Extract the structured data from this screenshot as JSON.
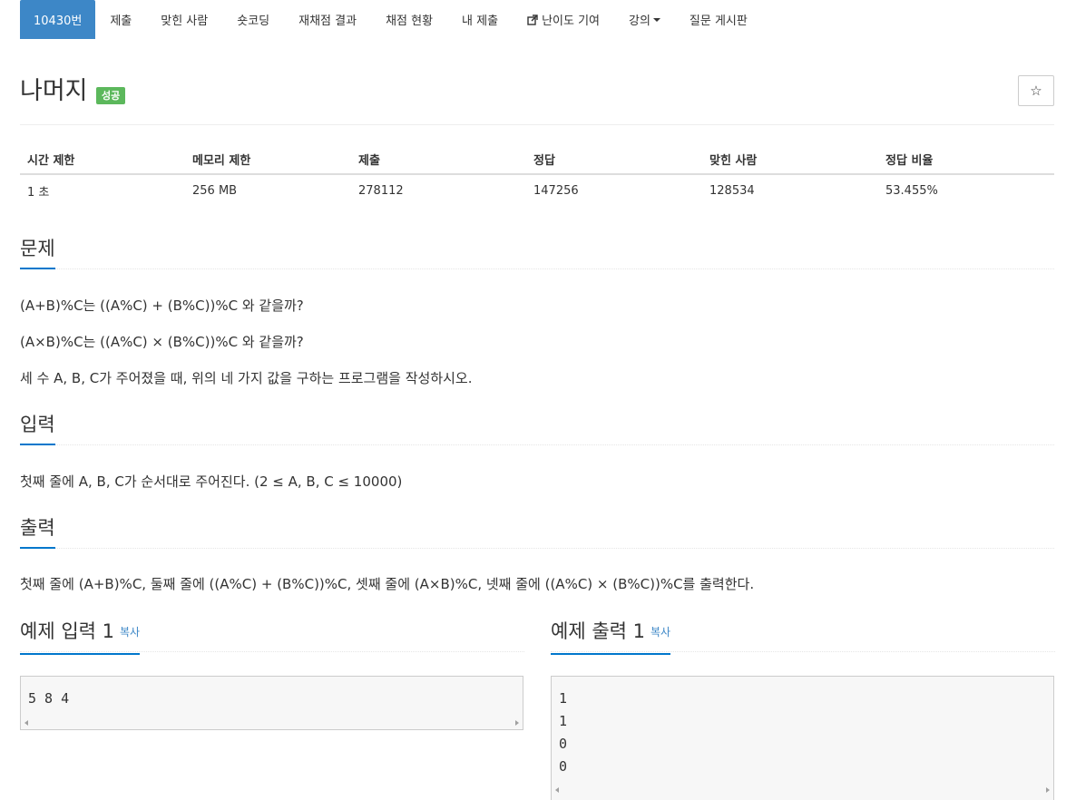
{
  "tabs": [
    {
      "label": "10430번",
      "active": true
    },
    {
      "label": "제출"
    },
    {
      "label": "맞힌 사람"
    },
    {
      "label": "숏코딩"
    },
    {
      "label": "재채점 결과"
    },
    {
      "label": "채점 현황"
    },
    {
      "label": "내 제출"
    },
    {
      "label": "난이도 기여",
      "icon": "external-link-icon"
    },
    {
      "label": "강의",
      "icon": "caret-down-icon"
    },
    {
      "label": "질문 게시판"
    }
  ],
  "problem": {
    "title": "나머지",
    "badge": "성공",
    "star": "☆"
  },
  "info": {
    "headers": [
      "시간 제한",
      "메모리 제한",
      "제출",
      "정답",
      "맞힌 사람",
      "정답 비율"
    ],
    "values": [
      "1 초",
      "256 MB",
      "278112",
      "147256",
      "128534",
      "53.455%"
    ]
  },
  "sections": {
    "problem_heading": "문제",
    "problem_lines": [
      "(A+B)%C는 ((A%C) + (B%C))%C 와 같을까?",
      "(A×B)%C는 ((A%C) × (B%C))%C 와 같을까?",
      "세 수 A, B, C가 주어졌을 때, 위의 네 가지 값을 구하는 프로그램을 작성하시오."
    ],
    "input_heading": "입력",
    "input_text": "첫째 줄에 A, B, C가 순서대로 주어진다. (2 ≤ A, B, C ≤ 10000)",
    "output_heading": "출력",
    "output_text": "첫째 줄에 (A+B)%C, 둘째 줄에 ((A%C) + (B%C))%C, 셋째 줄에 (A×B)%C, 넷째 줄에 ((A%C) × (B%C))%C를 출력한다."
  },
  "samples": {
    "input_heading": "예제 입력 1",
    "output_heading": "예제 출력 1",
    "copy_label": "복사",
    "input_lines": [
      "5 8 4"
    ],
    "output_lines": [
      "1",
      "1",
      "0",
      "0"
    ]
  },
  "colors": {
    "active_tab": "#3d87c7",
    "badge_success": "#5cb85c",
    "heading_underline": "#0077cc",
    "link": "#3d87c7"
  }
}
